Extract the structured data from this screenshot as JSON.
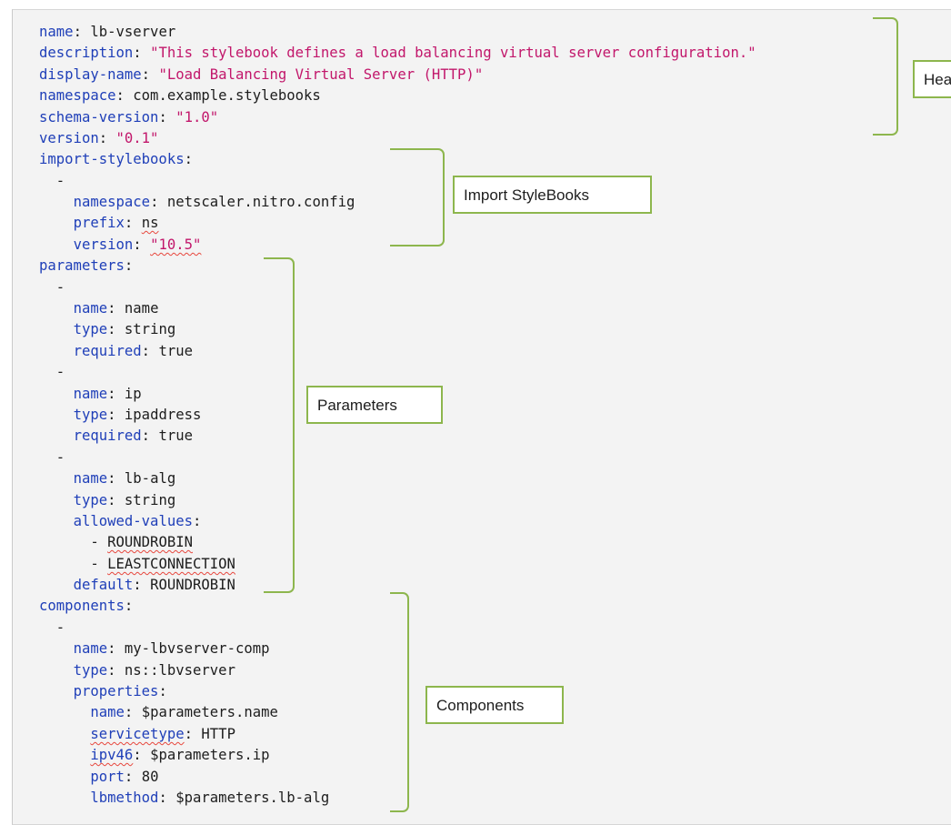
{
  "code": {
    "name_key": "name",
    "name_value": "lb-vserver",
    "description_key": "description",
    "description_value": "\"This stylebook defines a load balancing virtual server configuration.\"",
    "display_name_key": "display-name",
    "display_name_value": "\"Load Balancing Virtual Server (HTTP)\"",
    "namespace_key": "namespace",
    "namespace_value": "com.example.stylebooks",
    "schema_version_key": "schema-version",
    "schema_version_value": "\"1.0\"",
    "version_key": "version",
    "version_value": "\"0.1\"",
    "import_stylebooks_key": "import-stylebooks",
    "dash": "-",
    "import": {
      "namespace_key": "namespace",
      "namespace_value": "netscaler.nitro.config",
      "prefix_key": "prefix",
      "prefix_value": "ns",
      "version_key": "version",
      "version_value": "\"10.5\""
    },
    "parameters_key": "parameters",
    "parameters": [
      {
        "name_key": "name",
        "name_value": "name",
        "type_key": "type",
        "type_value": "string",
        "required_key": "required",
        "required_value": "true"
      },
      {
        "name_key": "name",
        "name_value": "ip",
        "type_key": "type",
        "type_value": "ipaddress",
        "required_key": "required",
        "required_value": "true"
      },
      {
        "name_key": "name",
        "name_value": "lb-alg",
        "type_key": "type",
        "type_value": "string",
        "allowed_values_key": "allowed-values",
        "allowed_values": [
          "ROUNDROBIN",
          "LEASTCONNECTION"
        ],
        "default_key": "default",
        "default_value": "ROUNDROBIN"
      }
    ],
    "components_key": "components",
    "component": {
      "name_key": "name",
      "name_value": "my-lbvserver-comp",
      "type_key": "type",
      "type_value": "ns::lbvserver",
      "properties_key": "properties",
      "properties": [
        {
          "key": "name",
          "value": "$parameters.name"
        },
        {
          "key": "servicetype",
          "value": "HTTP"
        },
        {
          "key": "ipv46",
          "value": "$parameters.ip"
        },
        {
          "key": "port",
          "value": "80"
        },
        {
          "key": "lbmethod",
          "value": "$parameters.lb-alg"
        }
      ]
    }
  },
  "labels": {
    "header": "Header",
    "import": "Import StyleBooks",
    "parameters": "Parameters",
    "components": "Components"
  },
  "colors": {
    "key": "#1f3fb8",
    "string": "#c2176b",
    "bracket": "#8db64d",
    "spellcheck": "#e7473d",
    "background": "#f3f3f3"
  }
}
